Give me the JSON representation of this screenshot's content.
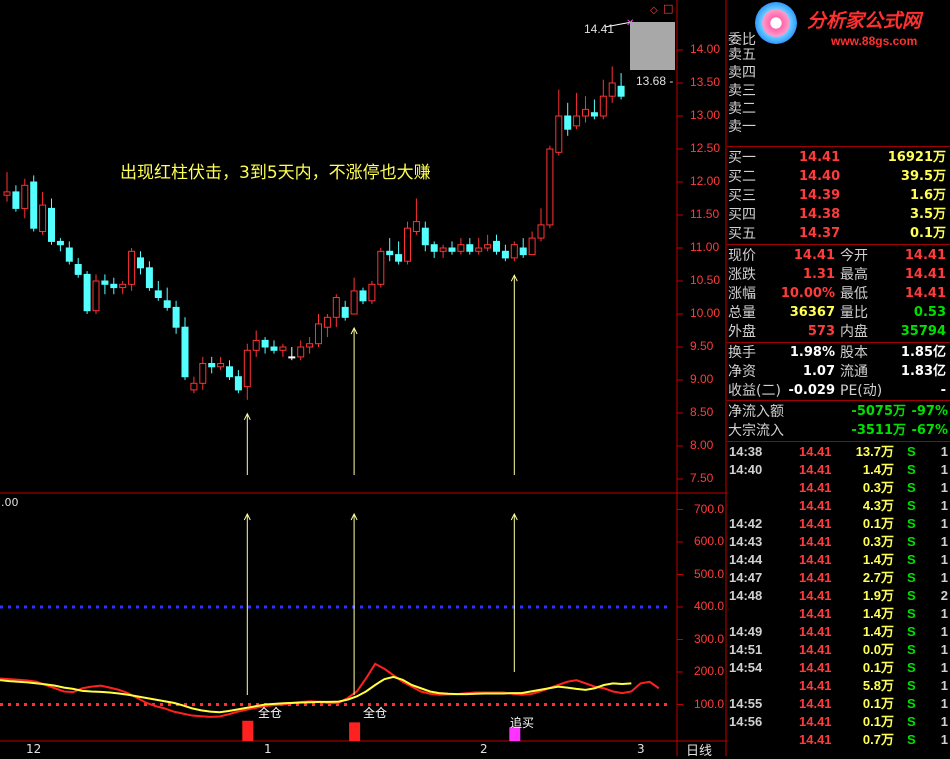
{
  "logo": {
    "name": "分析家公式网",
    "url": "www.88gs.com"
  },
  "annotation": "出现红柱伏击，3到5天内，不涨停也大赚",
  "price_labels": {
    "high": "14.41",
    "current": "13.68 -"
  },
  "price_axis": [
    "14.00",
    "13.50",
    "13.00",
    "12.50",
    "12.00",
    "11.50",
    "11.00",
    "10.50",
    "10.00",
    "9.50",
    "9.00",
    "8.50",
    "8.00",
    "7.50"
  ],
  "indicator_axis": [
    "700.0",
    "600.0",
    "500.0",
    "400.0",
    "300.0",
    "200.0",
    "100.0"
  ],
  "indicator_topleft": ".00",
  "signal_labels": [
    "全仓",
    "全仓",
    "追买"
  ],
  "date_labels": [
    "12",
    "1",
    "2",
    "3"
  ],
  "period_label": "日线",
  "order_book": {
    "title": "委比",
    "sells": [
      {
        "label": "卖五",
        "price": "",
        "vol": ""
      },
      {
        "label": "卖四",
        "price": "",
        "vol": ""
      },
      {
        "label": "卖三",
        "price": "",
        "vol": ""
      },
      {
        "label": "卖二",
        "price": "",
        "vol": ""
      },
      {
        "label": "卖一",
        "price": "",
        "vol": ""
      }
    ],
    "buys": [
      {
        "label": "买一",
        "price": "14.41",
        "vol": "16921万"
      },
      {
        "label": "买二",
        "price": "14.40",
        "vol": "39.5万"
      },
      {
        "label": "买三",
        "price": "14.39",
        "vol": "1.6万"
      },
      {
        "label": "买四",
        "price": "14.38",
        "vol": "3.5万"
      },
      {
        "label": "买五",
        "price": "14.37",
        "vol": "0.1万"
      }
    ]
  },
  "quote": [
    {
      "l1": "现价",
      "v1": "14.41",
      "l2": "今开",
      "v2": "14.41"
    },
    {
      "l1": "涨跌",
      "v1": "1.31",
      "l2": "最高",
      "v2": "14.41"
    },
    {
      "l1": "涨幅",
      "v1": "10.00%",
      "l2": "最低",
      "v2": "14.41"
    },
    {
      "l1": "总量",
      "v1": "36367",
      "l2": "量比",
      "v2": "0.53"
    },
    {
      "l1": "外盘",
      "v1": "573",
      "l2": "内盘",
      "v2": "35794"
    }
  ],
  "finance": [
    {
      "l1": "换手",
      "v1": "1.98%",
      "l2": "股本",
      "v2": "1.85亿"
    },
    {
      "l1": "净资",
      "v1": "1.07",
      "l2": "流通",
      "v2": "1.83亿"
    },
    {
      "l1": "收益(二)",
      "v1": "-0.029",
      "l2": "PE(动)",
      "v2": "-"
    }
  ],
  "flow": [
    {
      "label": "净流入额",
      "value": "-5075万",
      "pct": "-97%"
    },
    {
      "label": "大宗流入",
      "value": "-3511万",
      "pct": "-67%"
    }
  ],
  "ticks": [
    {
      "time": "14:38",
      "price": "14.41",
      "vol": "13.7万",
      "side": "S",
      "n": "1"
    },
    {
      "time": "14:40",
      "price": "14.41",
      "vol": "1.4万",
      "side": "S",
      "n": "1"
    },
    {
      "time": "",
      "price": "14.41",
      "vol": "0.3万",
      "side": "S",
      "n": "1"
    },
    {
      "time": "",
      "price": "14.41",
      "vol": "4.3万",
      "side": "S",
      "n": "1"
    },
    {
      "time": "14:42",
      "price": "14.41",
      "vol": "0.1万",
      "side": "S",
      "n": "1"
    },
    {
      "time": "14:43",
      "price": "14.41",
      "vol": "0.3万",
      "side": "S",
      "n": "1"
    },
    {
      "time": "14:44",
      "price": "14.41",
      "vol": "1.4万",
      "side": "S",
      "n": "1"
    },
    {
      "time": "14:47",
      "price": "14.41",
      "vol": "2.7万",
      "side": "S",
      "n": "1"
    },
    {
      "time": "14:48",
      "price": "14.41",
      "vol": "1.9万",
      "side": "S",
      "n": "2"
    },
    {
      "time": "",
      "price": "14.41",
      "vol": "1.4万",
      "side": "S",
      "n": "1"
    },
    {
      "time": "14:49",
      "price": "14.41",
      "vol": "1.4万",
      "side": "S",
      "n": "1"
    },
    {
      "time": "14:51",
      "price": "14.41",
      "vol": "0.0万",
      "side": "S",
      "n": "1"
    },
    {
      "time": "14:54",
      "price": "14.41",
      "vol": "0.1万",
      "side": "S",
      "n": "1"
    },
    {
      "time": "",
      "price": "14.41",
      "vol": "5.8万",
      "side": "S",
      "n": "1"
    },
    {
      "time": "14:55",
      "price": "14.41",
      "vol": "0.1万",
      "side": "S",
      "n": "1"
    },
    {
      "time": "14:56",
      "price": "14.41",
      "vol": "0.1万",
      "side": "S",
      "n": "1"
    },
    {
      "time": "",
      "price": "14.41",
      "vol": "0.7万",
      "side": "S",
      "n": "1"
    }
  ],
  "colors": {
    "up": "#ff3232",
    "down": "#54ffff",
    "flat": "#ffffff",
    "yellow": "#ffff54",
    "neutral": "#d0d0d0",
    "green": "#00e000",
    "frame": "#c00000"
  },
  "chart_data": {
    "type": "candlestick",
    "candles": [
      [
        11.8,
        11.85,
        12.15,
        11.7
      ],
      [
        11.85,
        11.6,
        11.95,
        11.55
      ],
      [
        11.6,
        11.95,
        12.05,
        11.45
      ],
      [
        12.0,
        11.3,
        12.1,
        11.25
      ],
      [
        11.25,
        11.65,
        11.85,
        11.2
      ],
      [
        11.6,
        11.1,
        11.75,
        11.05
      ],
      [
        11.1,
        11.05,
        11.15,
        10.95
      ],
      [
        11.0,
        10.8,
        11.1,
        10.75
      ],
      [
        10.75,
        10.6,
        10.85,
        10.55
      ],
      [
        10.6,
        10.05,
        10.65,
        10.0
      ],
      [
        10.05,
        10.5,
        10.6,
        10.0
      ],
      [
        10.5,
        10.45,
        10.6,
        10.3
      ],
      [
        10.45,
        10.4,
        10.55,
        10.3
      ],
      [
        10.4,
        10.45,
        10.5,
        10.3
      ],
      [
        10.45,
        10.95,
        11.0,
        10.35
      ],
      [
        10.85,
        10.7,
        10.95,
        10.6
      ],
      [
        10.7,
        10.4,
        10.8,
        10.35
      ],
      [
        10.35,
        10.25,
        10.5,
        10.2
      ],
      [
        10.2,
        10.1,
        10.4,
        10.05
      ],
      [
        10.1,
        9.8,
        10.2,
        9.7
      ],
      [
        9.8,
        9.05,
        9.95,
        9.0
      ],
      [
        8.85,
        8.95,
        9.05,
        8.8
      ],
      [
        8.95,
        9.25,
        9.35,
        8.85
      ],
      [
        9.25,
        9.2,
        9.35,
        9.1
      ],
      [
        9.2,
        9.25,
        9.35,
        9.15
      ],
      [
        9.2,
        9.05,
        9.3,
        9.0
      ],
      [
        9.05,
        8.85,
        9.15,
        8.8
      ],
      [
        8.9,
        9.45,
        9.55,
        8.7
      ],
      [
        9.45,
        9.6,
        9.75,
        9.35
      ],
      [
        9.6,
        9.5,
        9.65,
        9.4
      ],
      [
        9.5,
        9.45,
        9.6,
        9.4
      ],
      [
        9.45,
        9.5,
        9.55,
        9.35
      ],
      [
        9.35,
        9.35,
        9.5,
        9.3
      ],
      [
        9.35,
        9.5,
        9.6,
        9.3
      ],
      [
        9.5,
        9.55,
        9.65,
        9.4
      ],
      [
        9.55,
        9.85,
        10.0,
        9.5
      ],
      [
        9.8,
        9.95,
        10.0,
        9.65
      ],
      [
        9.95,
        10.25,
        10.3,
        9.8
      ],
      [
        10.1,
        9.95,
        10.2,
        9.9
      ],
      [
        10.0,
        10.35,
        10.55,
        10.0
      ],
      [
        10.35,
        10.2,
        10.4,
        10.15
      ],
      [
        10.2,
        10.45,
        10.5,
        10.15
      ],
      [
        10.45,
        10.95,
        11.0,
        10.4
      ],
      [
        10.95,
        10.9,
        11.15,
        10.8
      ],
      [
        10.9,
        10.8,
        11.1,
        10.75
      ],
      [
        10.8,
        11.3,
        11.4,
        10.75
      ],
      [
        11.25,
        11.4,
        11.75,
        11.2
      ],
      [
        11.3,
        11.05,
        11.4,
        10.95
      ],
      [
        11.05,
        10.95,
        11.1,
        10.85
      ],
      [
        10.95,
        11.0,
        11.05,
        10.85
      ],
      [
        11.0,
        10.95,
        11.1,
        10.9
      ],
      [
        10.95,
        11.05,
        11.15,
        10.9
      ],
      [
        11.05,
        10.95,
        11.15,
        10.9
      ],
      [
        10.95,
        11.0,
        11.15,
        10.9
      ],
      [
        11.0,
        11.05,
        11.2,
        10.95
      ],
      [
        11.1,
        10.95,
        11.2,
        10.9
      ],
      [
        10.95,
        10.85,
        11.05,
        10.8
      ],
      [
        10.85,
        11.05,
        11.1,
        10.8
      ],
      [
        11.0,
        10.9,
        11.15,
        10.85
      ],
      [
        10.9,
        11.15,
        11.25,
        10.9
      ],
      [
        11.15,
        11.35,
        11.6,
        11.1
      ],
      [
        11.35,
        12.5,
        12.55,
        11.3
      ],
      [
        12.45,
        13.0,
        13.4,
        12.4
      ],
      [
        13.0,
        12.8,
        13.2,
        12.7
      ],
      [
        12.85,
        13.0,
        13.35,
        12.8
      ],
      [
        13.0,
        13.1,
        13.3,
        12.9
      ],
      [
        13.05,
        13.0,
        13.25,
        12.95
      ],
      [
        13.0,
        13.3,
        13.55,
        12.95
      ],
      [
        13.3,
        13.5,
        13.75,
        13.2
      ],
      [
        13.45,
        13.3,
        13.65,
        13.25
      ]
    ],
    "arrows_at_candle": [
      27,
      39,
      57
    ],
    "indicator": {
      "reference_levels": [
        400,
        100
      ],
      "yellow": [
        175,
        172,
        170,
        168,
        165,
        162,
        158,
        152,
        148,
        142,
        140,
        139,
        137,
        134,
        130,
        125,
        120,
        115,
        110,
        105,
        97,
        88,
        82,
        78,
        76,
        80,
        85,
        90,
        95,
        100,
        102,
        104,
        105,
        106,
        107,
        108,
        108,
        109,
        115,
        125,
        140,
        160,
        178,
        185,
        176,
        160,
        150,
        140,
        135,
        133,
        132,
        132,
        133,
        134,
        134,
        134,
        135,
        135,
        140,
        145,
        150,
        155,
        152,
        148,
        145,
        150,
        160,
        165,
        163,
        165
      ],
      "red": [
        180,
        178,
        176,
        174,
        170,
        160,
        150,
        140,
        138,
        150,
        155,
        158,
        152,
        145,
        135,
        120,
        105,
        95,
        88,
        78,
        72,
        66,
        64,
        62,
        63,
        70,
        78,
        84,
        90,
        95,
        98,
        100,
        105,
        108,
        110,
        108,
        104,
        105,
        120,
        140,
        180,
        225,
        210,
        190,
        170,
        155,
        140,
        133,
        130,
        131,
        132,
        135,
        137,
        137,
        137,
        137,
        133,
        130,
        132,
        140,
        150,
        160,
        170,
        175,
        165,
        155,
        150,
        140,
        135,
        140,
        165,
        170,
        150
      ],
      "bars": [
        {
          "at": 27,
          "value": 50
        },
        {
          "at": 39,
          "value": 45
        }
      ],
      "magenta_bar": {
        "at": 57,
        "value": 30
      }
    }
  }
}
